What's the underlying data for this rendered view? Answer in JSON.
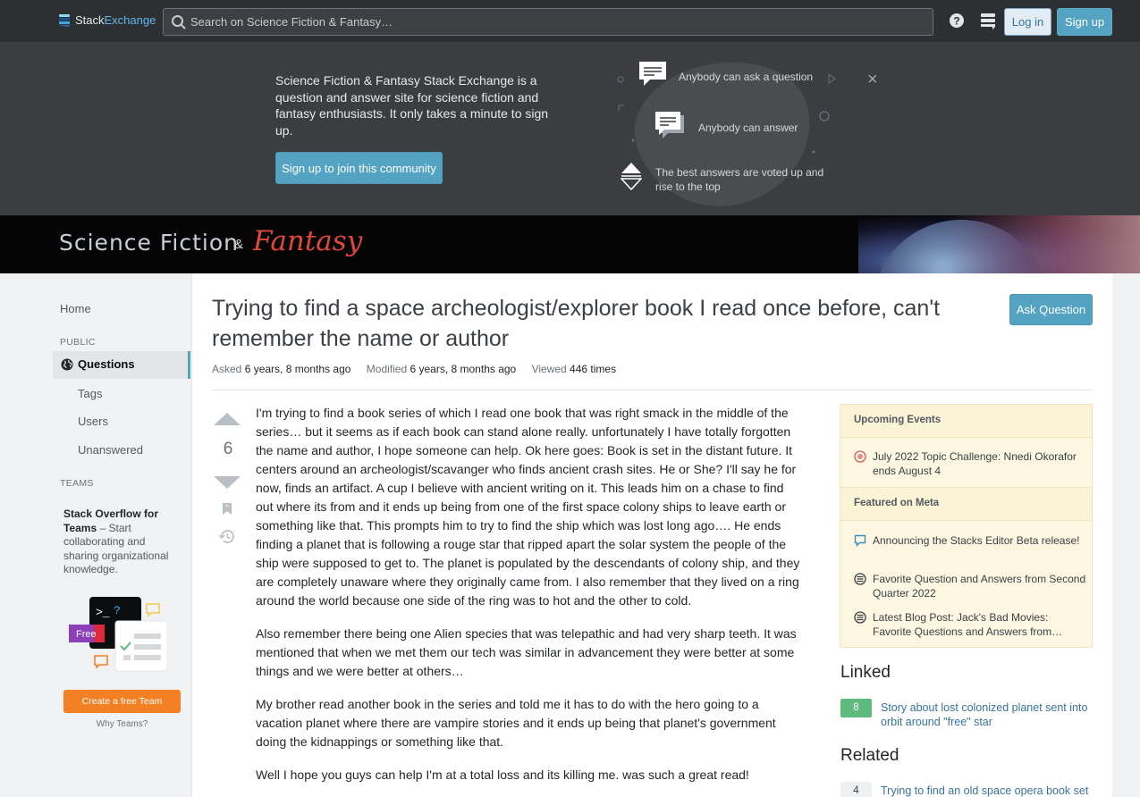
{
  "topbar": {
    "logo_part1": "Stack",
    "logo_part2": "Exchange",
    "search_placeholder": "Search on Science Fiction & Fantasy…",
    "login_label": "Log in",
    "signup_label": "Sign up",
    "icons": [
      "search-icon",
      "help-icon",
      "site-switcher-icon"
    ]
  },
  "hero": {
    "text": "Science Fiction & Fantasy Stack Exchange is a question and answer site for science fiction and fantasy enthusiasts. It only takes a minute to sign up.",
    "button": "Sign up to join this community",
    "items": [
      "Anybody can ask a question",
      "Anybody can answer",
      "The best answers are voted up and rise to the top"
    ],
    "close": "×"
  },
  "banner": {
    "title_part1": "Science Fiction",
    "amp": "&",
    "title_part2": "Fantasy"
  },
  "leftnav": {
    "home": "Home",
    "public_label": "PUBLIC",
    "questions": "Questions",
    "tags": "Tags",
    "users": "Users",
    "unanswered": "Unanswered",
    "teams_label": "TEAMS",
    "teams_title": "Stack Overflow for Teams",
    "teams_dash": " – Start collaborating and sharing organizational knowledge.",
    "free_badge": "Free",
    "team_button": "Create a free Team",
    "why_teams": "Why Teams?"
  },
  "question": {
    "title": "Trying to find a space archeologist/explorer book I read once before, can't remember the name or author",
    "ask_button": "Ask Question",
    "asked_label": "Asked",
    "asked_value": "6 years, 8 months ago",
    "modified_label": "Modified",
    "modified_value": "6 years, 8 months ago",
    "viewed_label": "Viewed",
    "viewed_value": "446 times",
    "vote_count": "6",
    "paragraphs": [
      "I'm trying to find a book series of which I read one book that was right smack in the middle of the series… but it seems as if each book can stand alone really. unfortunately I have totally forgotten the name and author, I hope someone can help. Ok here goes: Book is set in the distant future. It centers around an archeologist/scavanger who finds ancient crash sites. He or She? I'll say he for now, finds an artifact. A cup I believe with ancient writing on it. This leads him on a chase to find out where its from and it ends up being from one of the first space colony ships to leave earth or something like that. This prompts him to try to find the ship which was lost long ago…. He ends finding a planet that is following a rouge star that ripped apart the solar system the people of the ship were supposed to get to. The planet is populated by the descendants of colony ship, and they are completely unaware where they originally came from. I also remember that they lived on a ring around the world because one side of the ring was to hot and the other to cold.",
      "Also remember there being one Alien species that was telepathic and had very sharp teeth. It was mentioned that when we met them our tech was similar in advancement they were better at some things and we were better at others…",
      "My brother read another book in the series and told me it has to do with the hero going to a vacation planet where there are vampire stories and it ends up being that planet's government doing the kidnappings or something like that.",
      "Well I hope you guys can help I'm at a total loss and its killing me. was such a great read!"
    ]
  },
  "sidebar": {
    "upcoming_header": "Upcoming Events",
    "upcoming_item": "July 2022 Topic Challenge: Nnedi Okorafor ends August 4",
    "meta_header": "Featured on Meta",
    "meta_items": [
      "Announcing the Stacks Editor Beta release!",
      "Favorite Question and Answers from Second Quarter 2022",
      "Latest Blog Post: Jack's Bad Movies: Favorite Questions and Answers from…"
    ],
    "linked_header": "Linked",
    "linked": [
      {
        "score": "8",
        "title": "Story about lost colonized planet sent into orbit around \"free\" star"
      }
    ],
    "related_header": "Related",
    "related": [
      {
        "score": "4",
        "title": "Trying to find an old space opera book set"
      }
    ]
  },
  "colors": {
    "topbar": "#2d2f32",
    "hero": "#3b3d40",
    "accent": "#54a3c3",
    "link": "#39739d",
    "orange": "#f48024",
    "widget": "#fdf7e2"
  }
}
